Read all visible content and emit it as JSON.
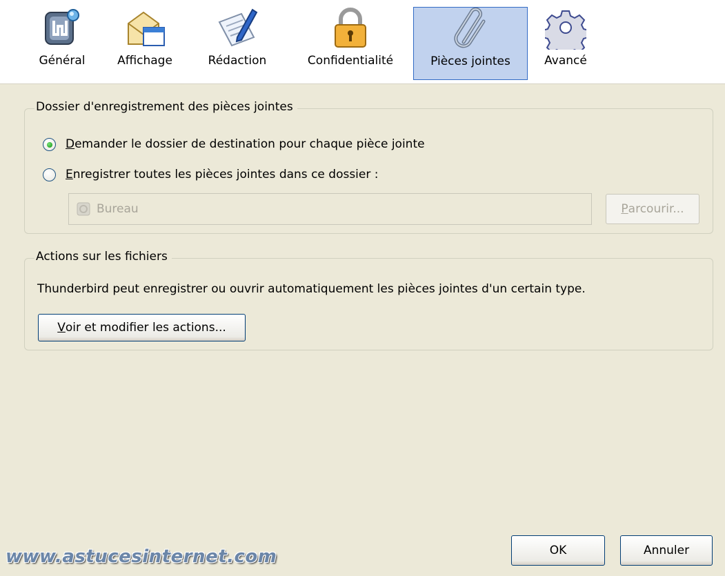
{
  "tabs": [
    {
      "label": "Général",
      "icon": "general-icon"
    },
    {
      "label": "Affichage",
      "icon": "display-icon"
    },
    {
      "label": "Rédaction",
      "icon": "compose-icon"
    },
    {
      "label": "Confidentialité",
      "icon": "lock-icon"
    },
    {
      "label": "Pièces jointes",
      "icon": "paperclip-icon",
      "selected": true
    },
    {
      "label": "Avancé",
      "icon": "gear-icon"
    }
  ],
  "save_folder": {
    "legend": "Dossier d'enregistrement des pièces jointes",
    "option_ask": {
      "accel": "D",
      "rest": "emander le dossier de destination pour chaque pièce jointe",
      "checked": true
    },
    "option_save": {
      "accel": "E",
      "rest": "nregistrer toutes les pièces jointes dans ce dossier :",
      "checked": false
    },
    "folder_value": "Bureau",
    "browse": {
      "accel": "P",
      "rest": "arcourir..."
    }
  },
  "file_actions": {
    "legend": "Actions sur les fichiers",
    "description": "Thunderbird peut enregistrer ou ouvrir automatiquement les pièces jointes d'un certain type.",
    "button": {
      "accel": "V",
      "rest": "oir et modifier les actions..."
    }
  },
  "dialog_buttons": {
    "ok": "OK",
    "cancel": "Annuler"
  },
  "watermark": "www.astucesinternet.com",
  "colors": {
    "background": "#ECE9D8",
    "selected_tab": "#C1D2EE",
    "selected_tab_border": "#316AC5",
    "button_border": "#003C74"
  }
}
